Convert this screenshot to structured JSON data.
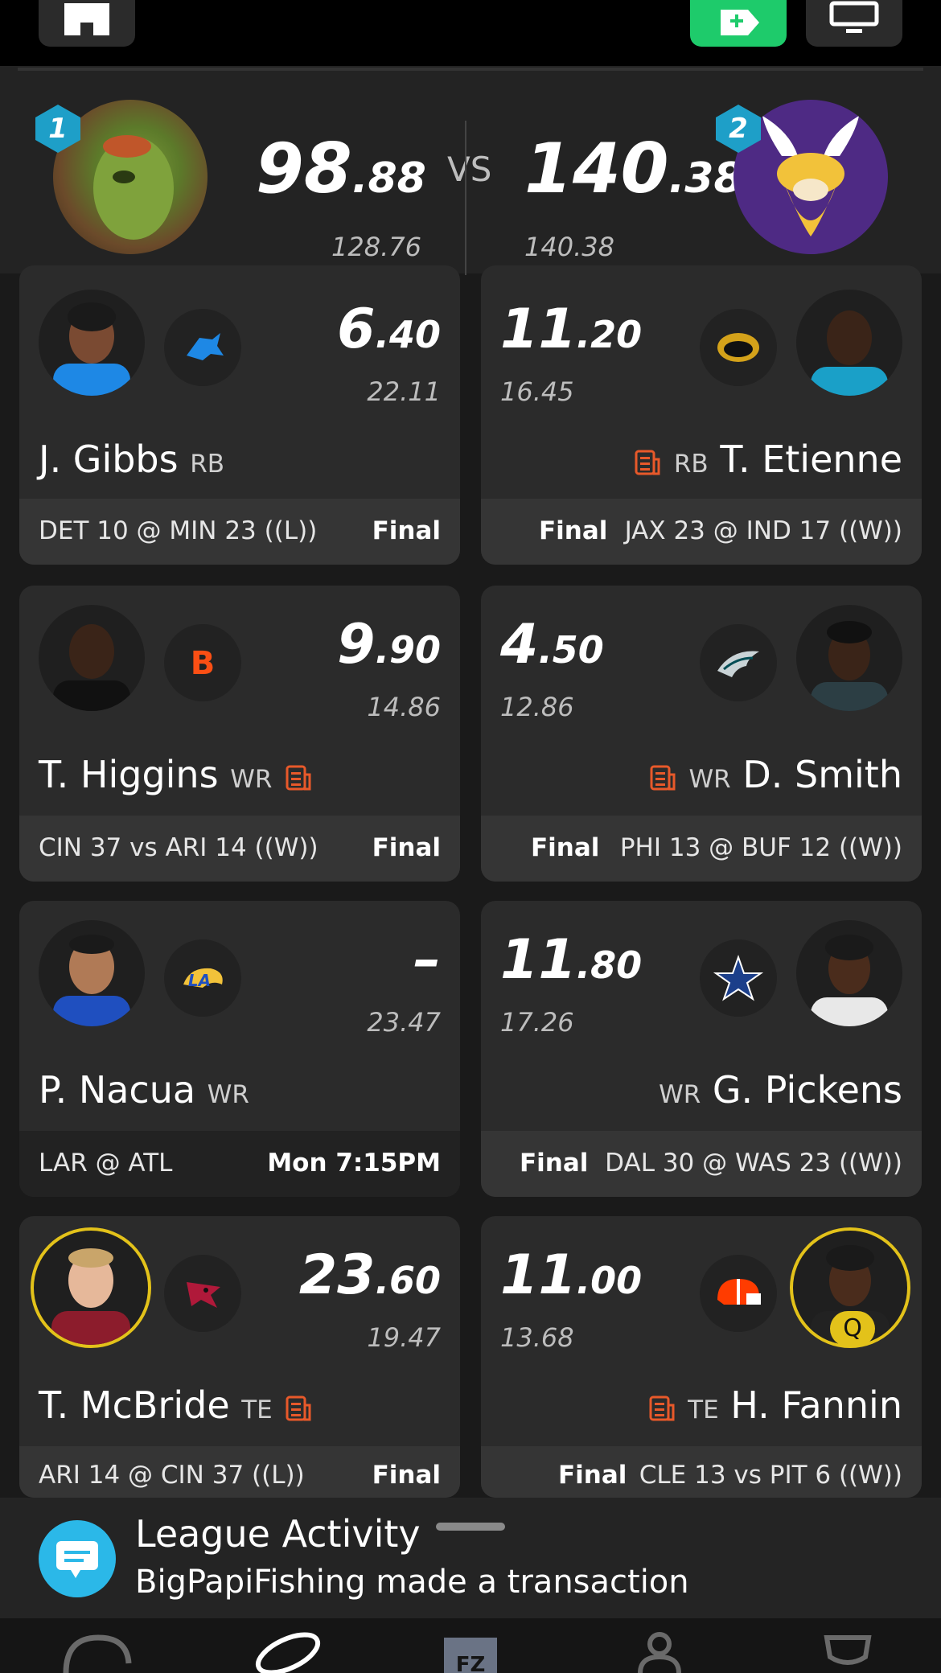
{
  "scoreboard": {
    "team1": {
      "rank": "1",
      "score_int": "98",
      "score_dec": ".88",
      "projected": "128.76"
    },
    "team2": {
      "rank": "2",
      "score_int": "140",
      "score_dec": ".38",
      "projected": "140.38"
    },
    "vs": "VS"
  },
  "cards": [
    {
      "name": "J. Gibbs",
      "pos": "RB",
      "score_int": "6",
      "score_dec": ".40",
      "proj": "22.11",
      "game": "DET 10 @ MIN 23 ((L))",
      "status": "Final",
      "team_logo": "lions-logo"
    },
    {
      "name": "T. Etienne",
      "pos": "RB",
      "score_int": "11",
      "score_dec": ".20",
      "proj": "16.45",
      "game": "JAX 23 @ IND 17 ((W))",
      "status": "Final",
      "team_logo": "jaguars-logo"
    },
    {
      "name": "T. Higgins",
      "pos": "WR",
      "score_int": "9",
      "score_dec": ".90",
      "proj": "14.86",
      "game": "CIN 37 vs ARI 14 ((W))",
      "status": "Final",
      "team_logo": "bengals-logo"
    },
    {
      "name": "D. Smith",
      "pos": "WR",
      "score_int": "4",
      "score_dec": ".50",
      "proj": "12.86",
      "game": "PHI 13 @ BUF 12 ((W))",
      "status": "Final",
      "team_logo": "eagles-logo"
    },
    {
      "name": "P. Nacua",
      "pos": "WR",
      "score_int": "–",
      "score_dec": "",
      "proj": "23.47",
      "game": "LAR @ ATL",
      "status": "Mon 7:15PM",
      "team_logo": "rams-logo"
    },
    {
      "name": "G. Pickens",
      "pos": "WR",
      "score_int": "11",
      "score_dec": ".80",
      "proj": "17.26",
      "game": "DAL 30 @ WAS 23 ((W))",
      "status": "Final",
      "team_logo": "cowboys-logo"
    },
    {
      "name": "T. McBride",
      "pos": "TE",
      "score_int": "23",
      "score_dec": ".60",
      "proj": "19.47",
      "game": "ARI 14 @ CIN 37 ((L))",
      "status": "Final",
      "team_logo": "cardinals-logo"
    },
    {
      "name": "H. Fannin",
      "pos": "TE",
      "score_int": "11",
      "score_dec": ".00",
      "proj": "13.68",
      "game": "CLE 13 vs PIT 6 ((W))",
      "status": "Final",
      "team_logo": "browns-logo",
      "badge": "Q"
    }
  ],
  "activity": {
    "title": "League Activity",
    "text": "BigPapiFishing made a transaction"
  },
  "nav": {
    "items": [
      "helmet-icon",
      "football-icon",
      "fz-shield-icon",
      "profile-icon",
      "trophy-icon"
    ]
  },
  "colors": {
    "accent_green": "#1ecb6b",
    "news_orange": "#e8592a",
    "flag_yellow": "#e3c21a",
    "badge_blue": "#1e9fc8"
  }
}
